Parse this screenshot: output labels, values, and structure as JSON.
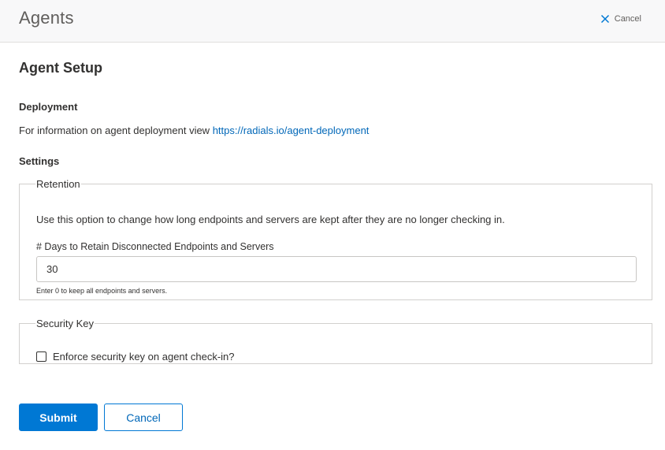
{
  "header": {
    "title": "Agents",
    "cancel_label": "Cancel"
  },
  "page": {
    "title": "Agent Setup"
  },
  "deployment": {
    "heading": "Deployment",
    "text": "For information on agent deployment view ",
    "link_text": "https://radials.io/agent-deployment"
  },
  "settings": {
    "heading": "Settings",
    "retention": {
      "legend": "Retention",
      "description": "Use this option to change how long endpoints and servers are kept after they are no longer checking in.",
      "days_label": "# Days to Retain Disconnected Endpoints and Servers",
      "days_value": "30",
      "hint": "Enter 0 to keep all endpoints and servers."
    },
    "security_key": {
      "legend": "Security Key",
      "checkbox_label": "Enforce security key on agent check-in?",
      "checked": false
    }
  },
  "actions": {
    "submit_label": "Submit",
    "cancel_label": "Cancel"
  },
  "colors": {
    "primary": "#0078d4",
    "link": "#0067b8",
    "header_bg": "#f8f8f9"
  }
}
